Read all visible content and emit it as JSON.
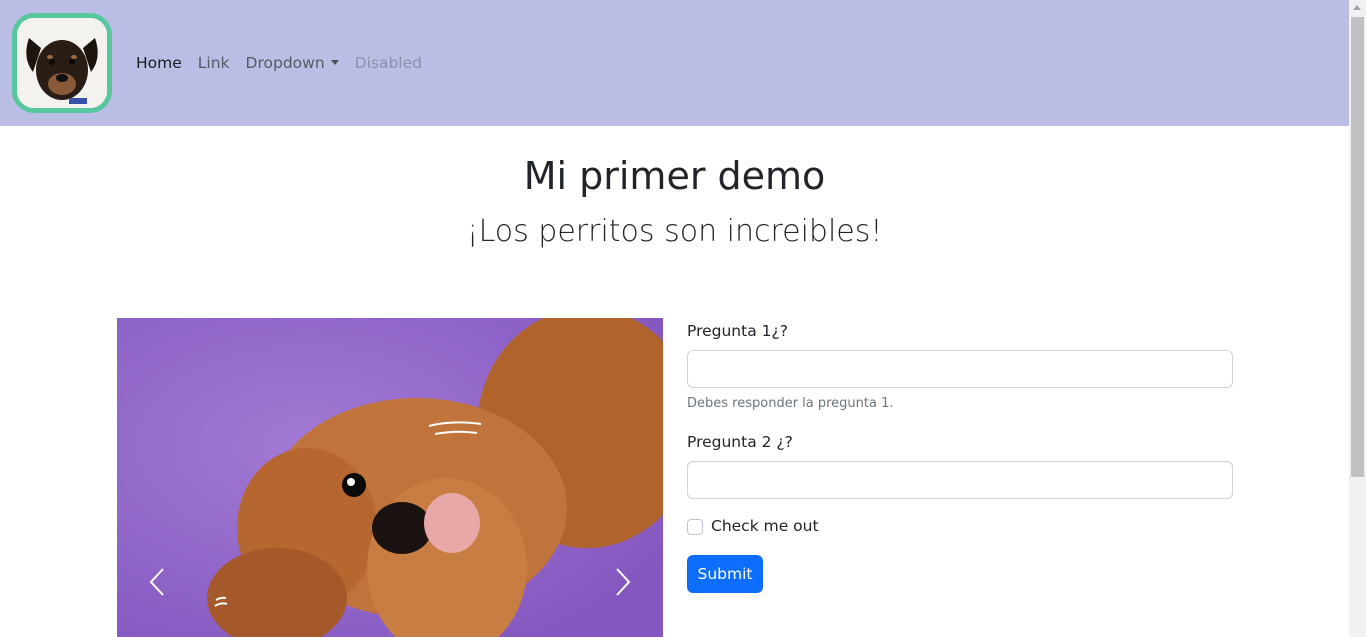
{
  "navbar": {
    "logo_alt": "dog avatar",
    "links": [
      {
        "label": "Home"
      },
      {
        "label": "Link"
      },
      {
        "label": "Dropdown"
      },
      {
        "label": "Disabled"
      }
    ]
  },
  "page": {
    "title": "Mi primer demo",
    "subtitle": "¡Los perritos son increibles!"
  },
  "carousel": {
    "prev_icon": "chevron-left-icon",
    "next_icon": "chevron-right-icon"
  },
  "form": {
    "q1_label": "Pregunta 1¿?",
    "q1_value": "",
    "q1_help": "Debes responder la pregunta 1.",
    "q2_label": "Pregunta 2 ¿?",
    "q2_value": "",
    "check_label": "Check me out",
    "submit_label": "Submit"
  },
  "colors": {
    "navbar_bg": "#babee4",
    "logo_border": "#5ac6a0",
    "primary": "#0d6efd",
    "carousel_bg": "#9167c8"
  }
}
